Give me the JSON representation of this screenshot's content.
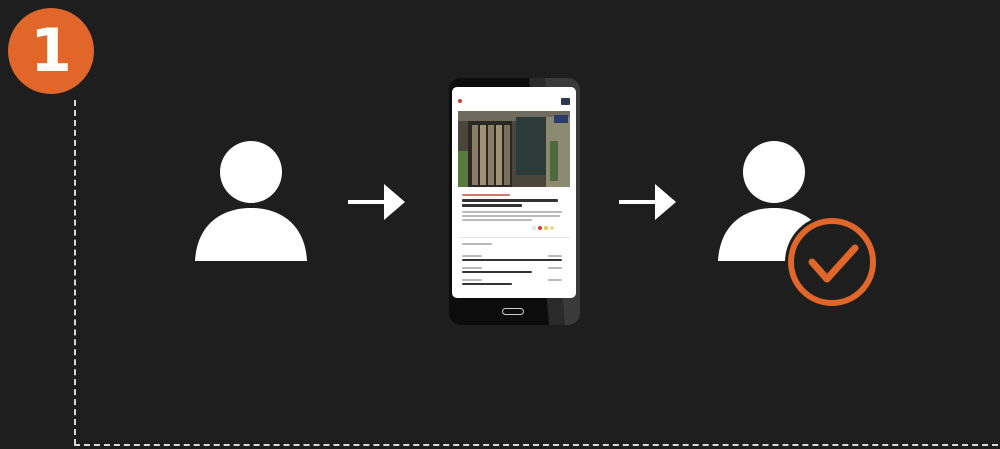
{
  "step": {
    "number": "1"
  },
  "colors": {
    "accent": "#e0662a",
    "background": "#1e1e1e",
    "icon": "#ffffff"
  },
  "icons": [
    "user-icon",
    "arrow-right-icon",
    "smartphone-icon",
    "arrow-right-icon",
    "verified-user-icon",
    "checkmark-icon"
  ]
}
